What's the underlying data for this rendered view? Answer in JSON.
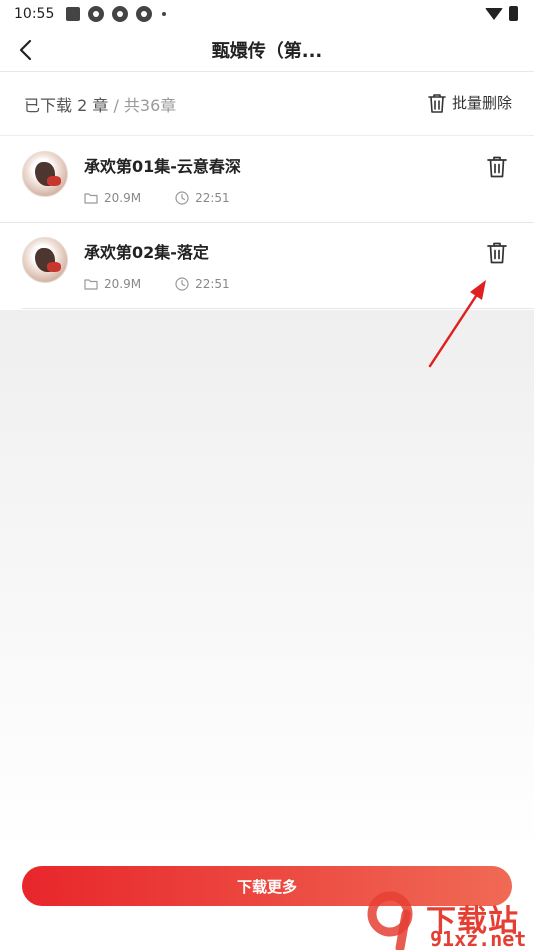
{
  "status_bar": {
    "time": "10:55"
  },
  "header": {
    "title": "甄嬛传（第..."
  },
  "summary": {
    "downloaded": "已下载 2 章",
    "separator": " / ",
    "total": "共36章",
    "batch_delete_label": "批量删除"
  },
  "list": {
    "items": [
      {
        "title": "承欢第01集-云意春深",
        "size": "20.9M",
        "duration": "22:51"
      },
      {
        "title": "承欢第02集-落定",
        "size": "20.9M",
        "duration": "22:51"
      }
    ]
  },
  "bottom": {
    "download_more_label": "下载更多"
  },
  "watermark": {
    "text": "下载站",
    "url": "91xz.net"
  },
  "colors": {
    "accent_start": "#e8262b",
    "accent_end": "#f06a55",
    "annotation_arrow": "#e02020"
  },
  "icons": [
    "back-arrow-icon",
    "trash-icon",
    "folder-icon",
    "clock-icon",
    "wifi-icon",
    "battery-icon"
  ]
}
